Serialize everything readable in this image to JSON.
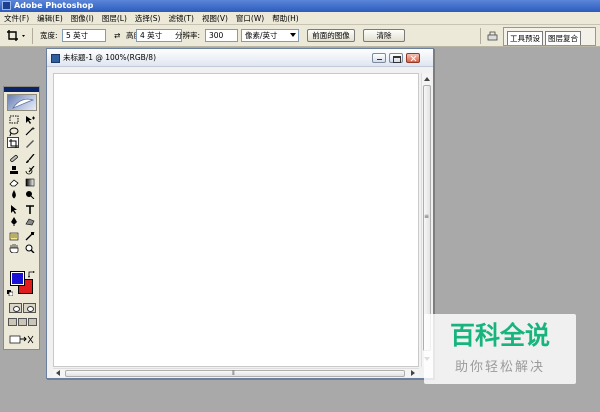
{
  "app": {
    "title": "Adobe Photoshop"
  },
  "menu": [
    "文件(F)",
    "编辑(E)",
    "图像(I)",
    "图层(L)",
    "选择(S)",
    "滤镜(T)",
    "视图(V)",
    "窗口(W)",
    "帮助(H)"
  ],
  "options": {
    "width_label": "宽度:",
    "width_value": "5 英寸",
    "height_label": "高度:",
    "height_value": "4 英寸",
    "resolution_label": "分辨率:",
    "resolution_value": "300",
    "unit_select": "像素/英寸",
    "front_image_button": "前面的图像",
    "clear_button": "清除",
    "palette_tabs": [
      "工具预设",
      "图层复合"
    ]
  },
  "document": {
    "title": "未标题-1 @ 100%(RGB/8)"
  },
  "toolbox": {
    "foreground_color": "#1a11d6",
    "background_color": "#e01c1c",
    "tools": [
      "marquee-icon",
      "move-icon",
      "lasso-icon",
      "magic-wand-icon",
      "crop-icon",
      "slice-icon",
      "healing-brush-icon",
      "brush-icon",
      "clone-stamp-icon",
      "history-brush-icon",
      "eraser-icon",
      "gradient-icon",
      "blur-icon",
      "dodge-icon",
      "path-select-icon",
      "type-icon",
      "pen-icon",
      "shape-icon",
      "notes-icon",
      "eyedropper-icon",
      "hand-icon",
      "zoom-icon"
    ]
  },
  "watermark": {
    "main": "百科全说",
    "sub": "助你轻松解决"
  }
}
